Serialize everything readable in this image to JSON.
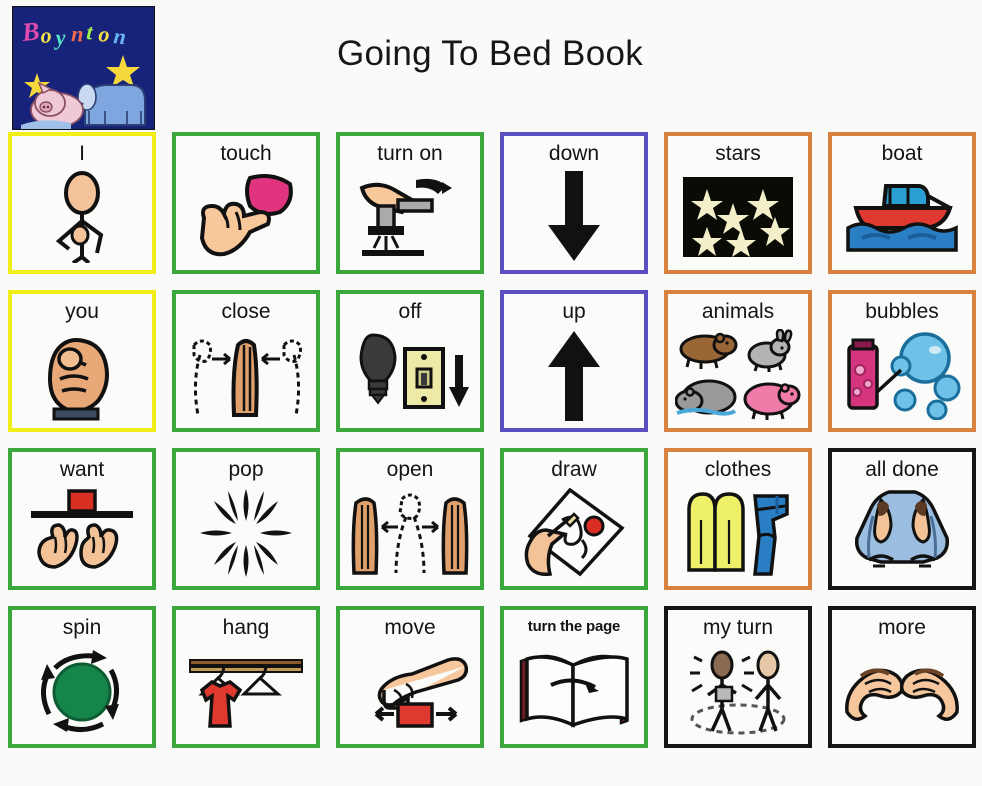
{
  "header": {
    "title": "Going To Bed Book",
    "book_cover": {
      "author_text": "Boynton",
      "alt": "book-cover-thumbnail"
    }
  },
  "colors": {
    "pronoun_border": "#f2ee18",
    "verb_border": "#3aa93a",
    "direction_border": "#5b4fc2",
    "noun_border": "#d9813f",
    "social_border": "#151515",
    "cell_background": "#fbfbf9",
    "page_background": "#fafaf8",
    "cover_background": "#17237a"
  },
  "board": {
    "columns": 6,
    "rows": 4,
    "cells": [
      {
        "label": "I",
        "icon": "person-pointing-self-icon",
        "border": "yellow",
        "row": 1,
        "col": 1
      },
      {
        "label": "touch",
        "icon": "hand-touching-icon",
        "border": "green",
        "row": 1,
        "col": 2
      },
      {
        "label": "turn on",
        "icon": "faucet-hand-icon",
        "border": "green",
        "row": 1,
        "col": 3
      },
      {
        "label": "down",
        "icon": "arrow-down-icon",
        "border": "purple",
        "row": 1,
        "col": 4
      },
      {
        "label": "stars",
        "icon": "night-sky-stars-icon",
        "border": "orange",
        "row": 1,
        "col": 5
      },
      {
        "label": "boat",
        "icon": "boat-icon",
        "border": "orange",
        "row": 1,
        "col": 6
      },
      {
        "label": "you",
        "icon": "hand-pointing-icon",
        "border": "yellow",
        "row": 2,
        "col": 1
      },
      {
        "label": "close",
        "icon": "hands-closing-icon",
        "border": "green",
        "row": 2,
        "col": 2
      },
      {
        "label": "off",
        "icon": "lightbulb-switch-off-icon",
        "border": "green",
        "row": 2,
        "col": 3
      },
      {
        "label": "up",
        "icon": "arrow-up-icon",
        "border": "purple",
        "row": 2,
        "col": 4
      },
      {
        "label": "animals",
        "icon": "animals-icon",
        "border": "orange",
        "row": 2,
        "col": 5
      },
      {
        "label": "bubbles",
        "icon": "bubbles-icon",
        "border": "orange",
        "row": 2,
        "col": 6
      },
      {
        "label": "want",
        "icon": "hands-reaching-block-icon",
        "border": "green",
        "row": 3,
        "col": 1
      },
      {
        "label": "pop",
        "icon": "burst-icon",
        "border": "green",
        "row": 3,
        "col": 2
      },
      {
        "label": "open",
        "icon": "hands-opening-icon",
        "border": "green",
        "row": 3,
        "col": 3
      },
      {
        "label": "draw",
        "icon": "hand-drawing-icon",
        "border": "green",
        "row": 3,
        "col": 4
      },
      {
        "label": "clothes",
        "icon": "shirt-pants-icon",
        "border": "orange",
        "row": 3,
        "col": 5
      },
      {
        "label": "all done",
        "icon": "hands-all-done-icon",
        "border": "black",
        "row": 3,
        "col": 6
      },
      {
        "label": "spin",
        "icon": "spinning-circle-icon",
        "border": "green",
        "row": 4,
        "col": 1
      },
      {
        "label": "hang",
        "icon": "shirt-on-hanger-icon",
        "border": "green",
        "row": 4,
        "col": 2
      },
      {
        "label": "move",
        "icon": "hand-pushing-block-icon",
        "border": "green",
        "row": 4,
        "col": 3
      },
      {
        "label": "turn the page",
        "icon": "open-book-arrow-icon",
        "border": "green",
        "row": 4,
        "col": 4,
        "small_label": true
      },
      {
        "label": "my turn",
        "icon": "two-people-circle-icon",
        "border": "black",
        "row": 4,
        "col": 5
      },
      {
        "label": "more",
        "icon": "hands-more-icon",
        "border": "black",
        "row": 4,
        "col": 6
      }
    ]
  }
}
